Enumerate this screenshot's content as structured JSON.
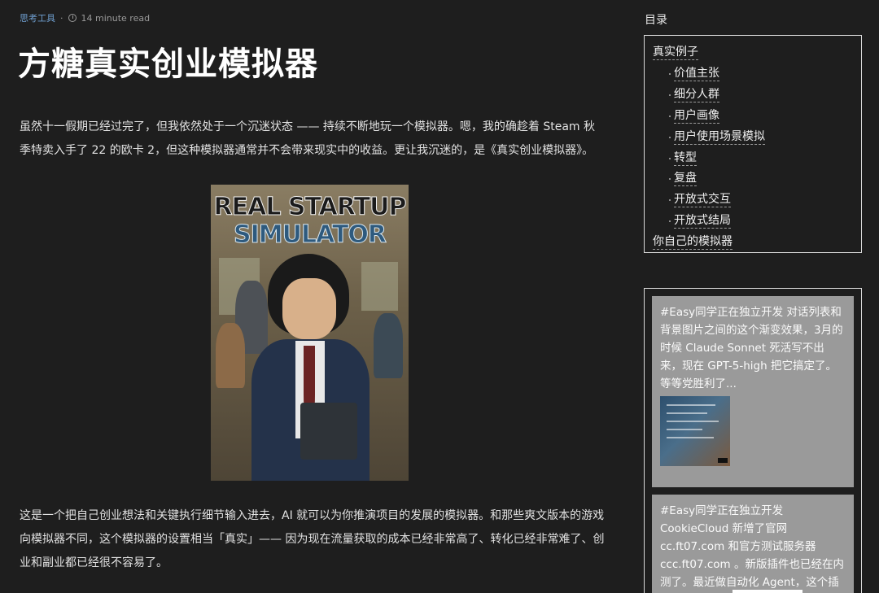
{
  "meta": {
    "category": "思考工具",
    "separator": "·",
    "read_time": "14 minute read"
  },
  "article": {
    "title": "方糖真实创业模拟器",
    "paragraph1": "虽然十一假期已经过完了，但我依然处于一个沉迷状态 —— 持续不断地玩一个模拟器。嗯，我的确趁着 Steam 秋季特卖入手了 22 的欧卡 2，但这种模拟器通常并不会带来现实中的收益。更让我沉迷的，是《真实创业模拟器》。",
    "cover_title_line1": "REAL STARTUP",
    "cover_title_line2": "SIMULATOR",
    "paragraph2": "这是一个把自己创业想法和关键执行细节输入进去，AI 就可以为你推演项目的发展的模拟器。和那些爽文版本的游戏向模拟器不同，这个模拟器的设置相当「真实」—— 因为现在流量获取的成本已经非常高了、转化已经非常难了、创业和副业都已经很不容易了。"
  },
  "toc": {
    "title": "目录",
    "items": [
      {
        "label": "真实例子",
        "level": 1
      },
      {
        "label": "价值主张",
        "level": 2
      },
      {
        "label": "细分人群",
        "level": 2
      },
      {
        "label": "用户画像",
        "level": 2
      },
      {
        "label": "用户使用场景模拟",
        "level": 2
      },
      {
        "label": "转型",
        "level": 2
      },
      {
        "label": "复盘",
        "level": 2
      },
      {
        "label": "开放式交互",
        "level": 2
      },
      {
        "label": "开放式结局",
        "level": 2
      },
      {
        "label": "你自己的模拟器",
        "level": 1
      }
    ]
  },
  "feed": {
    "cards": [
      {
        "text": "#Easy同学正在独立开发 对话列表和背景图片之间的这个渐变效果，3月的时候 Claude Sonnet 死活写不出来，现在 GPT-5-high 把它搞定了。等等党胜利了..."
      },
      {
        "text": "#Easy同学正在独立开发 CookieCloud 新增了官网 cc.ft07.com 和官方测试服务器 ccc.ft07.com 。新版插件也已经在内测了。最近做自动化 Agent，这个插件用得越来越多..."
      }
    ]
  },
  "colors": {
    "background": "#1e1e1e",
    "category_link": "#6f9fd0",
    "card_background": "#9a9a9a"
  }
}
